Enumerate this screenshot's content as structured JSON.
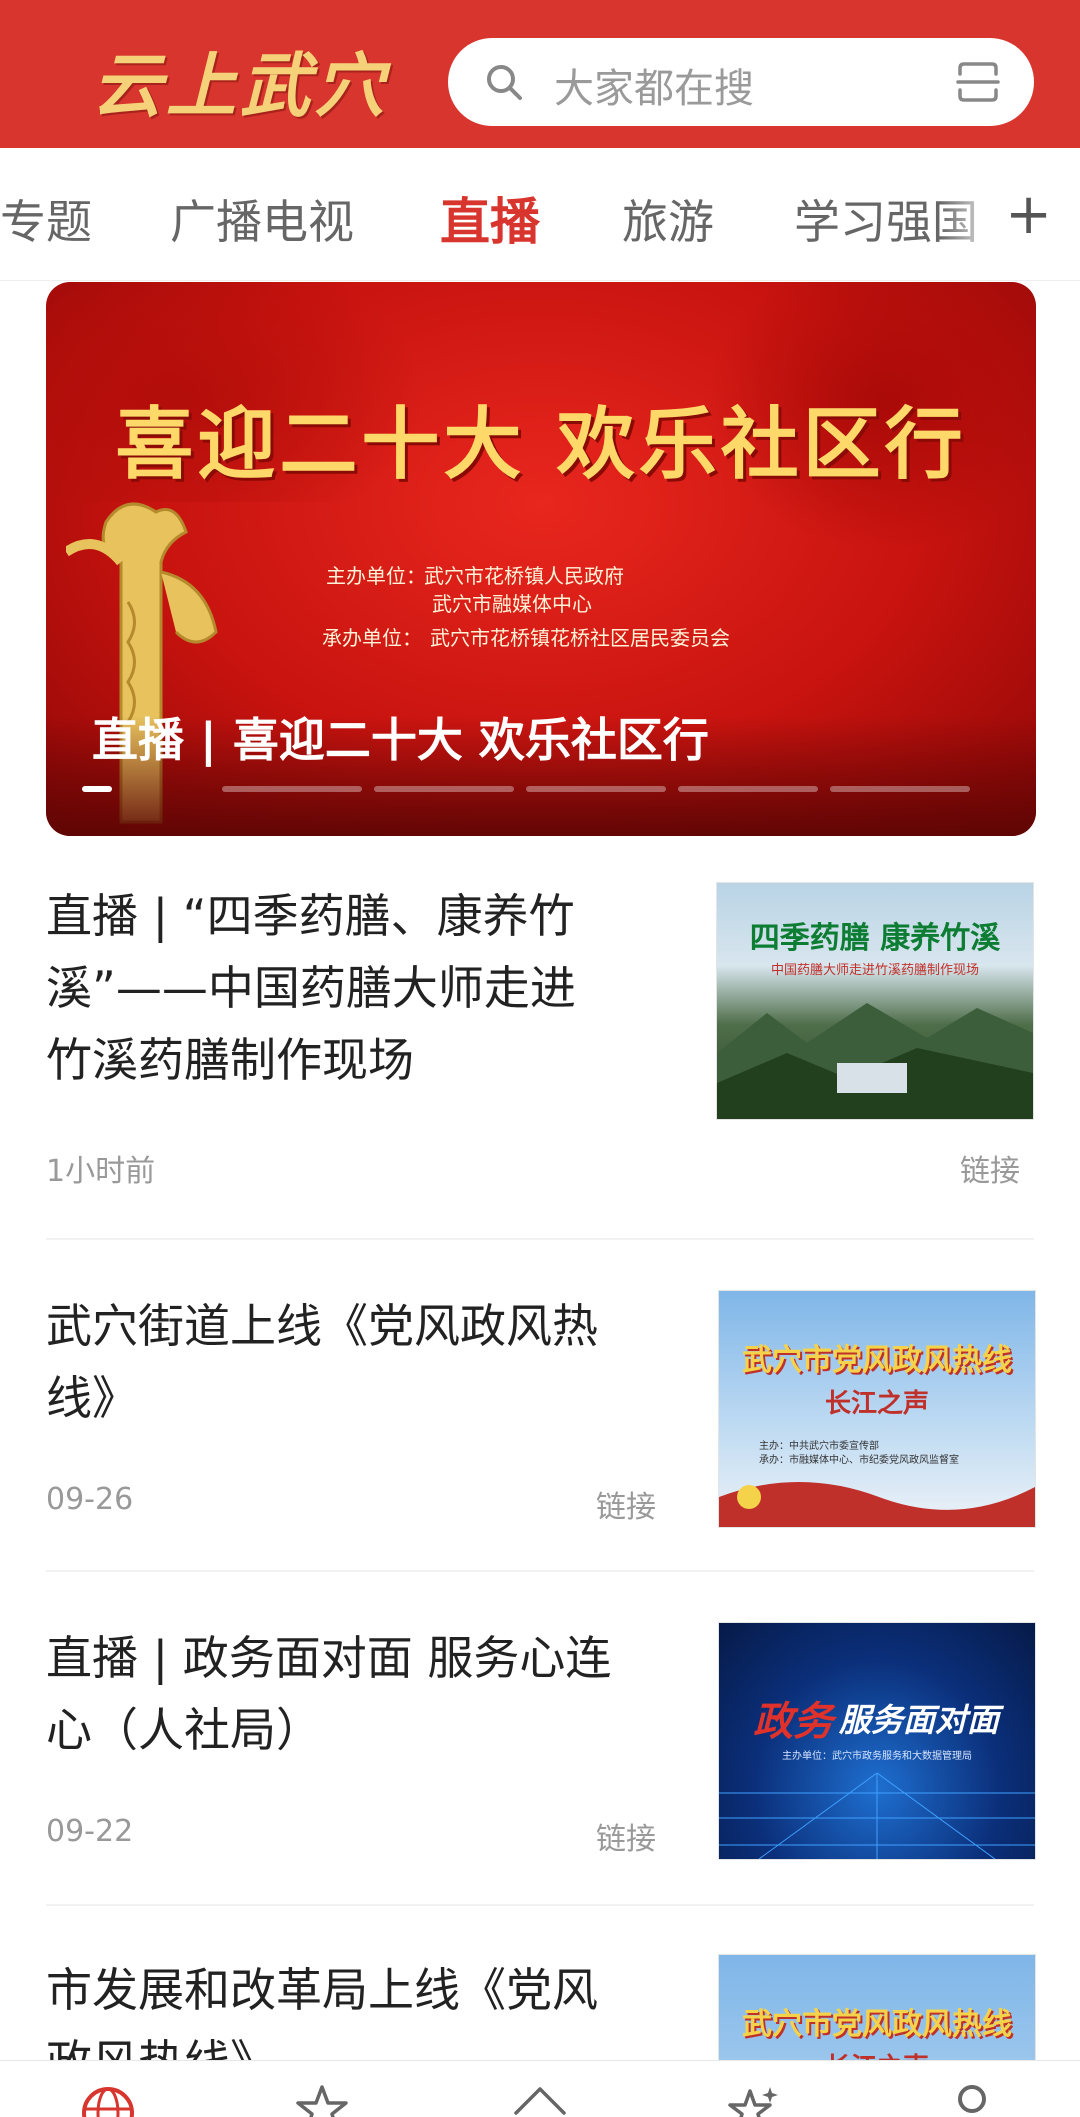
{
  "header": {
    "logo_text": "云上武穴",
    "search_placeholder": "大家都在搜"
  },
  "tabs": {
    "items": [
      "专题",
      "广播电视",
      "直播",
      "旅游",
      "学习强国"
    ],
    "active": "直播",
    "add_label": "+"
  },
  "banner": {
    "headline": "喜迎二十大  欢乐社区行",
    "organizer_label": "主办单位：",
    "organizer_1": "武穴市花桥镇人民政府",
    "organizer_2": "武穴市融媒体中心",
    "co_organizer_label": "承办单位：",
    "co_organizer": "武穴市花桥镇花桥社区居民委员会",
    "caption": "直播 | 喜迎二十大 欢乐社区行",
    "slide_count": 6,
    "active_slide": 1
  },
  "articles": [
    {
      "title_lines": [
        "直播 | “四季药膳、康养竹",
        "溪”——中国药膳大师走进",
        "竹溪药膳制作现场"
      ],
      "time": "1小时前",
      "tag": "链接",
      "thumb_title": "四季药膳  康养竹溪",
      "thumb_sub": "中国药膳大师走进竹溪药膳制作现场"
    },
    {
      "title_lines": [
        "武穴街道上线《党风政风热",
        "线》"
      ],
      "time": "09-26",
      "tag": "链接",
      "thumb_title": "武穴市党风政风热线",
      "thumb_sub": "长江之声",
      "thumb_org_1": "主办：中共武穴市委宣传部",
      "thumb_org_2": "承办：市融媒体中心、市纪委党风政风监督室"
    },
    {
      "title_lines": [
        "直播 | 政务面对面 服务心连",
        "心（人社局）"
      ],
      "time": "09-22",
      "tag": "链接",
      "thumb_title_1": "政务",
      "thumb_title_2": "服务面对面",
      "thumb_sub": "主办单位：武穴市政务服务和大数据管理局"
    },
    {
      "title_lines": [
        "市发展和改革局上线《党风",
        "政风热线》"
      ],
      "thumb_title": "武穴市党风政风热线",
      "thumb_sub": "长江之声"
    }
  ],
  "bottom_nav": {
    "icons": [
      "globe-icon",
      "star-icon",
      "home-icon",
      "sparkle-star-icon",
      "user-icon"
    ]
  },
  "colors": {
    "brand_red": "#d8352e",
    "gold": "#f5d27a"
  }
}
